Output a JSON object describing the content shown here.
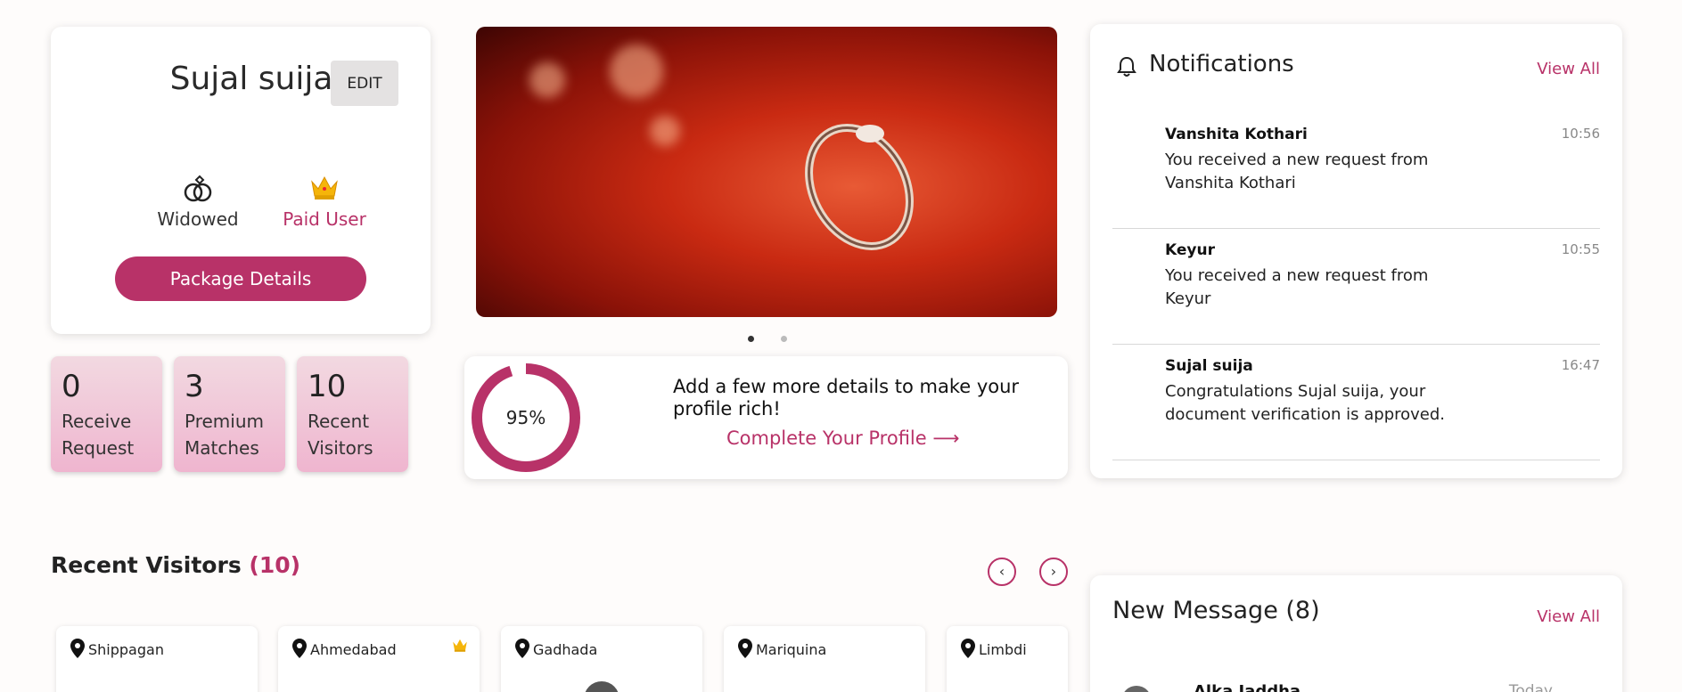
{
  "profile": {
    "name": "Sujal suija",
    "edit_label": "EDIT",
    "marital_status": "Widowed",
    "user_type": "Paid User",
    "package_button": "Package Details"
  },
  "stats": [
    {
      "value": "0",
      "label": "Receive Request"
    },
    {
      "value": "3",
      "label": "Premium Matches"
    },
    {
      "value": "10",
      "label": "Recent Visitors"
    }
  ],
  "carousel": {
    "slides": 2,
    "active_index": 0
  },
  "profile_completion": {
    "percent": 95,
    "percent_label": "95%",
    "message": "Add a few more details to make your profile rich!",
    "link_label": "Complete Your Profile",
    "link_arrow": "⟶"
  },
  "notifications": {
    "title": "Notifications",
    "view_all": "View All",
    "items": [
      {
        "name": "Vanshita Kothari",
        "time": "10:56",
        "message": "You received a new request from Vanshita Kothari"
      },
      {
        "name": "Keyur",
        "time": "10:55",
        "message": "You received a new request from Keyur"
      },
      {
        "name": "Sujal suija",
        "time": "16:47",
        "message": "Congratulations Sujal suija, your document verification is approved."
      }
    ]
  },
  "recent_visitors": {
    "title": "Recent Visitors",
    "count_label": "(10)",
    "prev_icon": "‹",
    "next_icon": "›",
    "items": [
      {
        "location": "Shippagan",
        "premium": false
      },
      {
        "location": "Ahmedabad",
        "premium": true
      },
      {
        "location": "Gadhada",
        "premium": false
      },
      {
        "location": "Mariquina",
        "premium": false
      },
      {
        "location": "Limbdi",
        "premium": false
      }
    ]
  },
  "new_message": {
    "title": "New Message (8)",
    "view_all": "View All",
    "first_sender": "Alka Jaddha",
    "first_time": "Today"
  },
  "colors": {
    "accent": "#b83268",
    "tile_top": "#f2d9e1",
    "tile_bottom": "#efb5cf"
  },
  "icons": {
    "rings": "rings-icon",
    "crown": "crown-icon",
    "bell": "bell-icon",
    "pin": "location-pin-icon"
  }
}
